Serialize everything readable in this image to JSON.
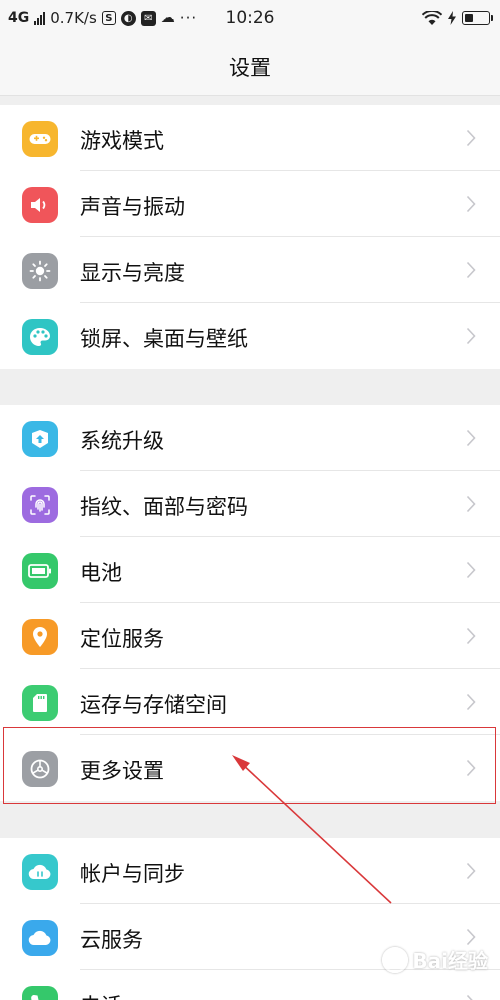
{
  "status_bar": {
    "network": "4G",
    "speed": "0.7K/s",
    "notification_icons": [
      "sim-s-icon",
      "browser-icon",
      "mail-icon",
      "cloud-icon"
    ],
    "more": "···",
    "time": "10:26",
    "battery_level": 0.35
  },
  "header": {
    "title": "设置"
  },
  "groups": [
    {
      "items": [
        {
          "label": "游戏模式",
          "icon": "gamepad-icon",
          "color": "#f7b62e"
        },
        {
          "label": "声音与振动",
          "icon": "speaker-icon",
          "color": "#f0555a"
        },
        {
          "label": "显示与亮度",
          "icon": "sun-icon",
          "color": "#9b9ea3"
        },
        {
          "label": "锁屏、桌面与壁纸",
          "icon": "palette-icon",
          "color": "#2fc5c4"
        }
      ]
    },
    {
      "items": [
        {
          "label": "系统升级",
          "icon": "upgrade-box-icon",
          "color": "#3ab8e6"
        },
        {
          "label": "指纹、面部与密码",
          "icon": "fingerprint-icon",
          "color": "#9d6be0"
        },
        {
          "label": "电池",
          "icon": "battery-icon",
          "color": "#35c86b"
        },
        {
          "label": "定位服务",
          "icon": "location-pin-icon",
          "color": "#f79a27"
        },
        {
          "label": "运存与存储空间",
          "icon": "sd-card-icon",
          "color": "#3ccc72"
        },
        {
          "label": "更多设置",
          "icon": "gear-icon",
          "color": "#9c9fa4"
        }
      ]
    },
    {
      "items": [
        {
          "label": "帐户与同步",
          "icon": "cloud-sync-icon",
          "color": "#36c8cc"
        },
        {
          "label": "云服务",
          "icon": "cloud-service-icon",
          "color": "#3aa9ec"
        },
        {
          "label": "电话",
          "icon": "phone-icon",
          "color": "#35c86b"
        }
      ]
    }
  ],
  "watermark": {
    "text": "Bai经验"
  },
  "colors": {
    "annotation": "#d9383a",
    "chevron": "#c7c7cc"
  }
}
